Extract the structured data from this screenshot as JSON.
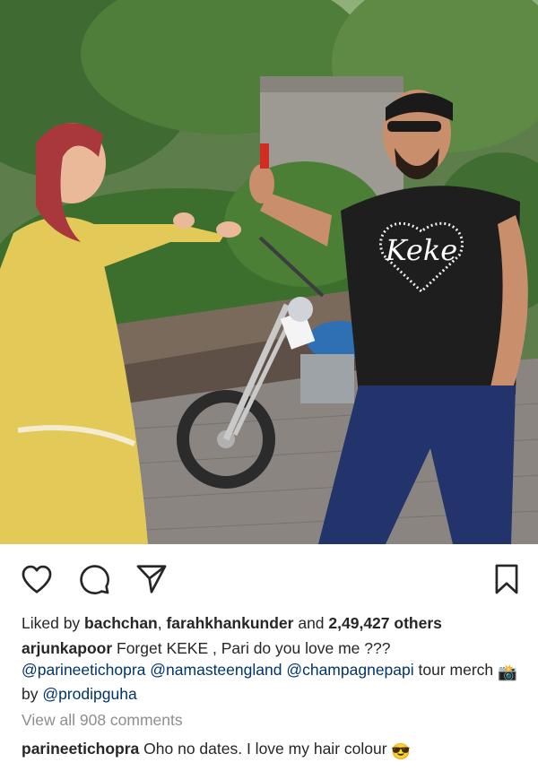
{
  "post": {
    "image_alt": "Woman in yellow dress and man in black KEKE t-shirt beside a blue motorcycle among tropical plants",
    "tshirt_text": "Keke",
    "actions": {
      "like_icon": "heart-icon",
      "comment_icon": "comment-icon",
      "share_icon": "send-icon",
      "save_icon": "bookmark-icon"
    },
    "likes": {
      "prefix": "Liked by ",
      "user1": "bachchan",
      "sep": ", ",
      "user2": "farahkhankunder",
      "and": " and ",
      "count": "2,49,427 others"
    },
    "caption": {
      "username": "arjunkapoor",
      "text": " Forget KEKE , Pari do you love me ???",
      "mention1": "@parineetichopra",
      "mention2": "@namasteengland",
      "mention3": "@champagnepapi",
      "tour": " tour merch ",
      "camera_emoji": "📸",
      "by": " by ",
      "mention4": "@prodipguha"
    },
    "view_comments": "View all 908 comments",
    "comment": {
      "username": "parineetichopra",
      "text": " Oho no dates. I love my hair colour ",
      "emoji": "😎"
    }
  },
  "colors": {
    "text": "#262626",
    "muted": "#8e8e8e",
    "mention": "#003569"
  }
}
